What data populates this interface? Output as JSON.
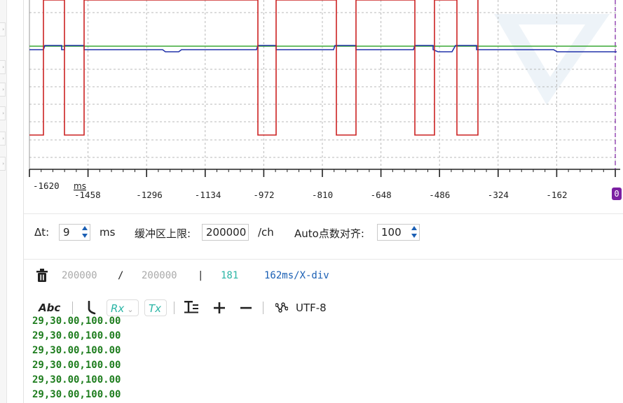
{
  "plot": {
    "x_ticks": [
      "-1620",
      "-1458",
      "-1296",
      "-1134",
      "-972",
      "-810",
      "-648",
      "-486",
      "-324",
      "-162",
      "0"
    ],
    "x_unit": "ms",
    "colors": {
      "red": "#cc2222",
      "blue": "#2233aa",
      "green": "#3aa935",
      "grid": "#b8b8b8",
      "cursor": "#7b1fa2"
    }
  },
  "settings": {
    "delta_t_label": "Δt:",
    "delta_t_value": "9",
    "delta_t_unit": "ms",
    "buffer_label": "缓冲区上限:",
    "buffer_value": "200000",
    "buffer_unit": "/ch",
    "auto_label": "Auto点数对齐:",
    "auto_value": "100"
  },
  "status": {
    "used": "200000",
    "slash": "/",
    "total": "200000",
    "bar": "|",
    "count": "181",
    "scale": "162ms/X-div"
  },
  "toolbar": {
    "abc_label": "Abc",
    "sep": "|",
    "rx_label": "Rx",
    "tx_label": "Tx",
    "encoding": "UTF-8",
    "icons": [
      "trash-icon",
      "abc-format-icon",
      "timestamp-icon",
      "rx-toggle-icon",
      "tx-toggle-icon",
      "text-format-icon",
      "plus-icon",
      "minus-icon",
      "graph-icon"
    ]
  },
  "log_lines": [
    "29,30.00,100.00",
    "29,30.00,100.00",
    "29,30.00,100.00",
    "29,30.00,100.00",
    "29,30.00,100.00",
    "29,30.00,100.00"
  ]
}
